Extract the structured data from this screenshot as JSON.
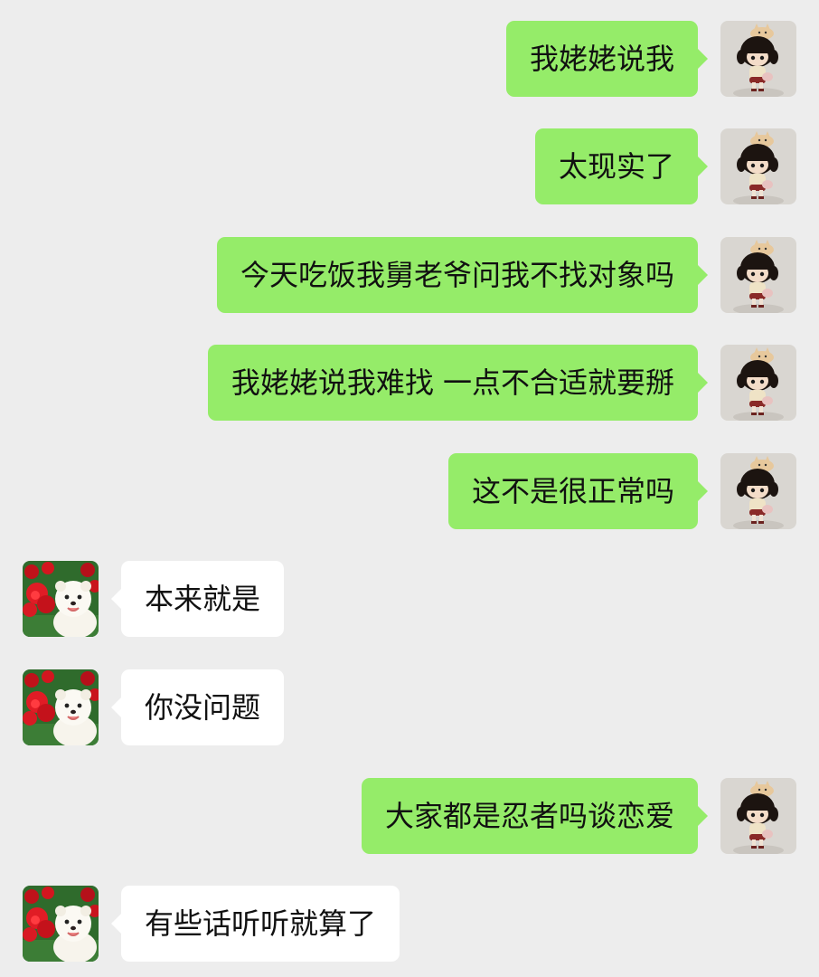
{
  "colors": {
    "background": "#ededed",
    "sent_bubble": "#95ec69",
    "received_bubble": "#ffffff",
    "text": "#111111"
  },
  "avatars": {
    "self": "doll-girl-avatar",
    "contact": "white-dog-with-roses-avatar"
  },
  "messages": [
    {
      "direction": "sent",
      "text": "我姥姥说我"
    },
    {
      "direction": "sent",
      "text": "太现实了"
    },
    {
      "direction": "sent",
      "text": "今天吃饭我舅老爷问我不找对象吗"
    },
    {
      "direction": "sent",
      "text": "我姥姥说我难找 一点不合适就要掰"
    },
    {
      "direction": "sent",
      "text": "这不是很正常吗"
    },
    {
      "direction": "received",
      "text": "本来就是"
    },
    {
      "direction": "received",
      "text": "你没问题"
    },
    {
      "direction": "sent",
      "text": "大家都是忍者吗谈恋爱"
    },
    {
      "direction": "received",
      "text": "有些话听听就算了"
    }
  ]
}
